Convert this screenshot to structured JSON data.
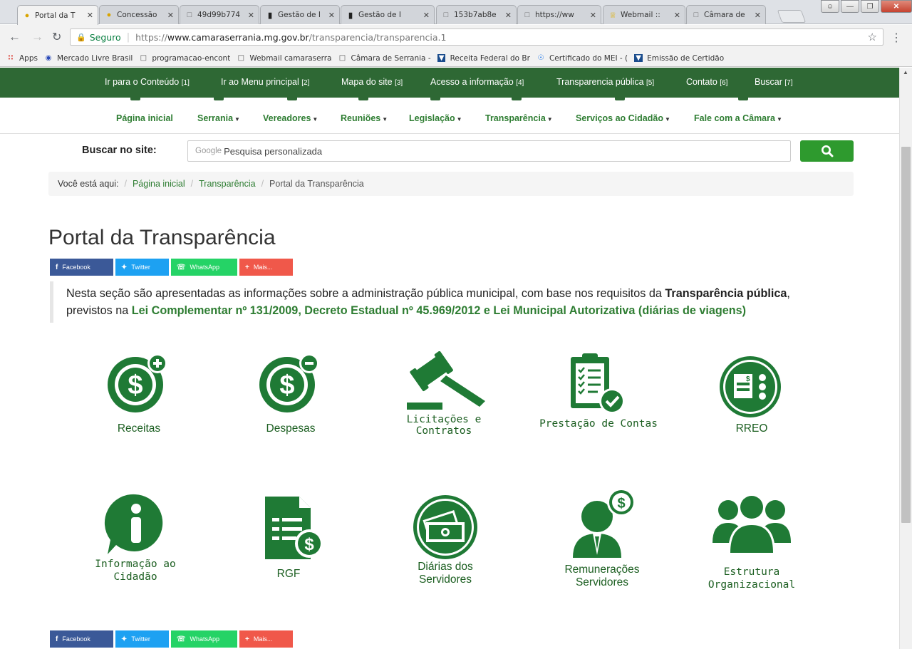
{
  "browser": {
    "tabs": [
      {
        "title": "Portal da T",
        "icon": "site-favicon",
        "active": true
      },
      {
        "title": "Concessão",
        "icon": "site-favicon"
      },
      {
        "title": "49d99b774",
        "icon": "document-icon"
      },
      {
        "title": "Gestão de I",
        "icon": "bars-favicon"
      },
      {
        "title": "Gestão de I",
        "icon": "bars-favicon"
      },
      {
        "title": "153b7ab8e",
        "icon": "document-icon"
      },
      {
        "title": "https://ww",
        "icon": "document-icon"
      },
      {
        "title": "Webmail ::",
        "icon": "crown-favicon"
      },
      {
        "title": "Câmara de",
        "icon": "document-icon"
      }
    ],
    "url": {
      "secure_label": "Seguro",
      "scheme": "https://",
      "host": "www.camaraserrania.mg.gov.br",
      "path": "/transparencia/transparencia.1"
    },
    "bookmarks": [
      {
        "label": "Apps",
        "icon": "apps-icon"
      },
      {
        "label": "Mercado Livre Brasil",
        "icon": "handshake-icon"
      },
      {
        "label": "programacao-encont",
        "icon": "document-icon"
      },
      {
        "label": "Webmail camaraserra",
        "icon": "document-icon"
      },
      {
        "label": "Câmara de Serrania -",
        "icon": "document-icon"
      },
      {
        "label": "Receita Federal do Br",
        "icon": "receita-icon"
      },
      {
        "label": "Certificado do MEI - (",
        "icon": "mei-icon"
      },
      {
        "label": "Emissão de Certidão",
        "icon": "receita-icon"
      }
    ]
  },
  "access_bar": [
    {
      "label": "Ir para o Conteúdo",
      "key": "[1]"
    },
    {
      "label": "Ir ao Menu principal",
      "key": "[2]"
    },
    {
      "label": "Mapa do site",
      "key": "[3]"
    },
    {
      "label": "Acesso a informação",
      "key": "[4]"
    },
    {
      "label": "Transparencia pública",
      "key": "[5]"
    },
    {
      "label": "Contato",
      "key": "[6]"
    },
    {
      "label": "Buscar",
      "key": "[7]"
    }
  ],
  "main_nav": [
    {
      "label": "Página inicial",
      "dropdown": false
    },
    {
      "label": "Serrania",
      "dropdown": true
    },
    {
      "label": "Vereadores",
      "dropdown": true
    },
    {
      "label": "Reuniões",
      "dropdown": true
    },
    {
      "label": "Legislação",
      "dropdown": true
    },
    {
      "label": "Transparência",
      "dropdown": true
    },
    {
      "label": "Serviços ao Cidadão",
      "dropdown": true
    },
    {
      "label": "Fale com a Câmara",
      "dropdown": true
    }
  ],
  "search": {
    "label": "Buscar no site:",
    "google_prefix": "Google",
    "placeholder": "Pesquisa personalizada"
  },
  "breadcrumb": {
    "prefix": "Você está aqui:",
    "items": [
      "Página inicial",
      "Transparência"
    ],
    "current": "Portal da Transparência"
  },
  "page_title": "Portal da Transparência",
  "share": [
    {
      "label": "Facebook",
      "icon": "facebook-icon",
      "color": "#3b5998"
    },
    {
      "label": "Twitter",
      "icon": "twitter-icon",
      "color": "#1da1f2"
    },
    {
      "label": "WhatsApp",
      "icon": "whatsapp-icon",
      "color": "#25d366"
    },
    {
      "label": "Mais...",
      "icon": "plus-icon",
      "color": "#f0584a"
    }
  ],
  "intro": {
    "text1": "Nesta seção são apresentadas as informações sobre a administração pública municipal, com base nos requisitos da ",
    "bold1": "Transparência pública",
    "text2": ", previstos na ",
    "bold2": "Lei Complementar nº 131/2009, Decreto Estadual nº 45.969/2012 e Lei Municipal Autorizativa (diárias de viagens)"
  },
  "grid": [
    {
      "label": "Receitas",
      "icon": "dollar-plus-icon"
    },
    {
      "label": "Despesas",
      "icon": "dollar-minus-icon"
    },
    {
      "label": "Licitações e Contratos",
      "icon": "gavel-icon"
    },
    {
      "label": "Prestação de Contas",
      "icon": "clipboard-check-icon"
    },
    {
      "label": "RREO",
      "icon": "report-checklist-icon"
    },
    {
      "label": "Informação ao Cidadão",
      "icon": "info-icon"
    },
    {
      "label": "RGF",
      "icon": "document-dollar-icon"
    },
    {
      "label": "Diárias dos Servidores",
      "icon": "money-circle-icon"
    },
    {
      "label": "Remunerações Servidores",
      "icon": "employee-dollar-icon"
    },
    {
      "label": "Estrutura Organizacional",
      "icon": "group-icon"
    }
  ],
  "colors": {
    "brand_green": "#2e6834",
    "link_green": "#2e7d32",
    "icon_green": "#1f7a35",
    "search_button": "#2e9a2e"
  }
}
